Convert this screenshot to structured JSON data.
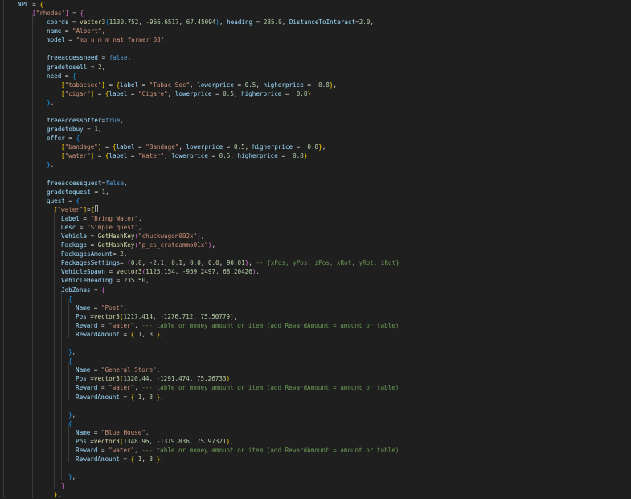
{
  "colors": {
    "background": "#1f1f1f",
    "text": "#d4d4d4",
    "keyword": "#569cd6",
    "variable": "#9cdcfe",
    "string": "#ce9178",
    "number": "#b5cea8",
    "function": "#dcdcaa",
    "comment": "#6a9955",
    "bracket_gold": "#ffd700",
    "bracket_pink": "#da70d6",
    "bracket_blue": "#179fff",
    "indent_guide": "#3b3b3b"
  },
  "lines": [
    [
      [
        "NPC",
        "variable"
      ],
      [
        " = ",
        "text"
      ],
      [
        "{",
        "bracket_gold"
      ]
    ],
    [
      [
        "[",
        "bracket_pink"
      ],
      [
        "\"rhodes\"",
        "string"
      ],
      [
        "]",
        "bracket_pink"
      ],
      [
        " = ",
        "text"
      ],
      [
        "{",
        "bracket_pink"
      ]
    ],
    [
      [
        "coords",
        "variable"
      ],
      [
        " = ",
        "text"
      ],
      [
        "vector3",
        "function"
      ],
      [
        "(",
        "bracket_blue"
      ],
      [
        "1130.752",
        "number"
      ],
      [
        ", ",
        "text"
      ],
      [
        "-966.6517",
        "number"
      ],
      [
        ", ",
        "text"
      ],
      [
        "67.45094",
        "number"
      ],
      [
        ")",
        "bracket_blue"
      ],
      [
        ", ",
        "text"
      ],
      [
        "heading",
        "variable"
      ],
      [
        " = ",
        "text"
      ],
      [
        "285.0",
        "number"
      ],
      [
        ", ",
        "text"
      ],
      [
        "DistanceToInteract",
        "variable"
      ],
      [
        "=",
        "text"
      ],
      [
        "2.0",
        "number"
      ],
      [
        ",",
        "text"
      ]
    ],
    [
      [
        "name",
        "variable"
      ],
      [
        " = ",
        "text"
      ],
      [
        "\"Albert\"",
        "string"
      ],
      [
        ",",
        "text"
      ]
    ],
    [
      [
        "model",
        "variable"
      ],
      [
        " = ",
        "text"
      ],
      [
        "\"mp_u_m_m_nat_farmer_03\"",
        "string"
      ],
      [
        ",",
        "text"
      ]
    ],
    [],
    [
      [
        "freeaccessneed",
        "variable"
      ],
      [
        " = ",
        "text"
      ],
      [
        "false",
        "keyword"
      ],
      [
        ",",
        "text"
      ]
    ],
    [
      [
        "gradetosell",
        "variable"
      ],
      [
        " = ",
        "text"
      ],
      [
        "2",
        "number"
      ],
      [
        ",",
        "text"
      ]
    ],
    [
      [
        "need",
        "variable"
      ],
      [
        " = ",
        "text"
      ],
      [
        "{",
        "bracket_blue"
      ]
    ],
    [
      [
        "[",
        "bracket_gold"
      ],
      [
        "\"tabacsec\"",
        "string"
      ],
      [
        "]",
        "bracket_gold"
      ],
      [
        " = ",
        "text"
      ],
      [
        "{",
        "bracket_gold"
      ],
      [
        "label",
        "variable"
      ],
      [
        " = ",
        "text"
      ],
      [
        "\"Tabac Sec\"",
        "string"
      ],
      [
        ", ",
        "text"
      ],
      [
        "lowerprice",
        "variable"
      ],
      [
        " = ",
        "text"
      ],
      [
        "0.5",
        "number"
      ],
      [
        ", ",
        "text"
      ],
      [
        "higherprice",
        "variable"
      ],
      [
        " =  ",
        "text"
      ],
      [
        "0.8",
        "number"
      ],
      [
        "}",
        "bracket_gold"
      ],
      [
        ",",
        "text"
      ]
    ],
    [
      [
        "[",
        "bracket_gold"
      ],
      [
        "\"cigar\"",
        "string"
      ],
      [
        "]",
        "bracket_gold"
      ],
      [
        " = ",
        "text"
      ],
      [
        "{",
        "bracket_gold"
      ],
      [
        "label",
        "variable"
      ],
      [
        " = ",
        "text"
      ],
      [
        "\"Cigare\"",
        "string"
      ],
      [
        ", ",
        "text"
      ],
      [
        "lowerprice",
        "variable"
      ],
      [
        " = ",
        "text"
      ],
      [
        "0.5",
        "number"
      ],
      [
        ", ",
        "text"
      ],
      [
        "higherprice",
        "variable"
      ],
      [
        " =  ",
        "text"
      ],
      [
        "0.8",
        "number"
      ],
      [
        "}",
        "bracket_gold"
      ]
    ],
    [
      [
        "}",
        "bracket_blue"
      ],
      [
        ",",
        "text"
      ]
    ],
    [],
    [
      [
        "freeaccessoffer",
        "variable"
      ],
      [
        "=",
        "text"
      ],
      [
        "true",
        "keyword"
      ],
      [
        ",",
        "text"
      ]
    ],
    [
      [
        "gradetobuy",
        "variable"
      ],
      [
        " = ",
        "text"
      ],
      [
        "1",
        "number"
      ],
      [
        ",",
        "text"
      ]
    ],
    [
      [
        "offer",
        "variable"
      ],
      [
        " = ",
        "text"
      ],
      [
        "{",
        "bracket_blue"
      ]
    ],
    [
      [
        "[",
        "bracket_gold"
      ],
      [
        "\"bandage\"",
        "string"
      ],
      [
        "]",
        "bracket_gold"
      ],
      [
        " = ",
        "text"
      ],
      [
        "{",
        "bracket_gold"
      ],
      [
        "label",
        "variable"
      ],
      [
        " = ",
        "text"
      ],
      [
        "\"Bandage\"",
        "string"
      ],
      [
        ", ",
        "text"
      ],
      [
        "lowerprice",
        "variable"
      ],
      [
        " = ",
        "text"
      ],
      [
        "0.5",
        "number"
      ],
      [
        ", ",
        "text"
      ],
      [
        "higherprice",
        "variable"
      ],
      [
        " =  ",
        "text"
      ],
      [
        "0.8",
        "number"
      ],
      [
        "}",
        "bracket_gold"
      ],
      [
        ",",
        "text"
      ]
    ],
    [
      [
        "[",
        "bracket_gold"
      ],
      [
        "\"water\"",
        "string"
      ],
      [
        "]",
        "bracket_gold"
      ],
      [
        " = ",
        "text"
      ],
      [
        "{",
        "bracket_gold"
      ],
      [
        "label",
        "variable"
      ],
      [
        " = ",
        "text"
      ],
      [
        "\"Water\"",
        "string"
      ],
      [
        ", ",
        "text"
      ],
      [
        "lowerprice",
        "variable"
      ],
      [
        " = ",
        "text"
      ],
      [
        "0.5",
        "number"
      ],
      [
        ", ",
        "text"
      ],
      [
        "higherprice",
        "variable"
      ],
      [
        " =  ",
        "text"
      ],
      [
        "0.8",
        "number"
      ],
      [
        "}",
        "bracket_gold"
      ]
    ],
    [
      [
        "}",
        "bracket_blue"
      ],
      [
        ",",
        "text"
      ]
    ],
    [],
    [
      [
        "freeaccessquest",
        "variable"
      ],
      [
        "=",
        "text"
      ],
      [
        "false",
        "keyword"
      ],
      [
        ",",
        "text"
      ]
    ],
    [
      [
        "gradetoquest",
        "variable"
      ],
      [
        " = ",
        "text"
      ],
      [
        "1",
        "number"
      ],
      [
        ",",
        "text"
      ]
    ],
    [
      [
        "quest",
        "variable"
      ],
      [
        " = ",
        "text"
      ],
      [
        "{",
        "bracket_blue"
      ]
    ],
    [
      [
        "[",
        "bracket_gold"
      ],
      [
        "\"water\"",
        "string"
      ],
      [
        "]",
        "bracket_gold"
      ],
      [
        "=",
        "text"
      ],
      [
        "{",
        "bracket_gold"
      ]
    ],
    [
      [
        "Label",
        "variable"
      ],
      [
        " = ",
        "text"
      ],
      [
        "\"Bring Water\"",
        "string"
      ],
      [
        ",",
        "text"
      ]
    ],
    [
      [
        "Desc",
        "variable"
      ],
      [
        " = ",
        "text"
      ],
      [
        "\"Simple quest\"",
        "string"
      ],
      [
        ",",
        "text"
      ]
    ],
    [
      [
        "Vehicle",
        "variable"
      ],
      [
        " = ",
        "text"
      ],
      [
        "GetHashKey",
        "function"
      ],
      [
        "(",
        "bracket_pink"
      ],
      [
        "\"chuckwagon002x\"",
        "string"
      ],
      [
        ")",
        "bracket_pink"
      ],
      [
        ",",
        "text"
      ]
    ],
    [
      [
        "Package",
        "variable"
      ],
      [
        " = ",
        "text"
      ],
      [
        "GetHashKey",
        "function"
      ],
      [
        "(",
        "bracket_pink"
      ],
      [
        "\"p_cs_crateammo01x\"",
        "string"
      ],
      [
        ")",
        "bracket_pink"
      ],
      [
        ",",
        "text"
      ]
    ],
    [
      [
        "PackagesAmount",
        "variable"
      ],
      [
        "= ",
        "text"
      ],
      [
        "2",
        "number"
      ],
      [
        ",",
        "text"
      ]
    ],
    [
      [
        "PackagesSettings",
        "variable"
      ],
      [
        "= ",
        "text"
      ],
      [
        "{",
        "bracket_pink"
      ],
      [
        "0.0",
        "number"
      ],
      [
        ", ",
        "text"
      ],
      [
        "-2.1",
        "number"
      ],
      [
        ", ",
        "text"
      ],
      [
        "0.1",
        "number"
      ],
      [
        ", ",
        "text"
      ],
      [
        "0.0",
        "number"
      ],
      [
        ", ",
        "text"
      ],
      [
        "0.0",
        "number"
      ],
      [
        ", ",
        "text"
      ],
      [
        "90.01",
        "number"
      ],
      [
        "}",
        "bracket_pink"
      ],
      [
        ", ",
        "text"
      ],
      [
        "-- {xPos, yPos, zPos, xRot, yRot, zRot}",
        "comment"
      ]
    ],
    [
      [
        "VehicleSpawn",
        "variable"
      ],
      [
        " = ",
        "text"
      ],
      [
        "vector3",
        "function"
      ],
      [
        "(",
        "bracket_pink"
      ],
      [
        "1125.154",
        "number"
      ],
      [
        ", ",
        "text"
      ],
      [
        "-959.2497",
        "number"
      ],
      [
        ", ",
        "text"
      ],
      [
        "68.20426",
        "number"
      ],
      [
        ")",
        "bracket_pink"
      ],
      [
        ",",
        "text"
      ]
    ],
    [
      [
        "VehicleHeading",
        "variable"
      ],
      [
        " = ",
        "text"
      ],
      [
        "235.50",
        "number"
      ],
      [
        ",",
        "text"
      ]
    ],
    [
      [
        "JobZones",
        "variable"
      ],
      [
        " = ",
        "text"
      ],
      [
        "{",
        "bracket_pink"
      ]
    ],
    [
      [
        "{",
        "bracket_blue"
      ]
    ],
    [
      [
        "Name",
        "variable"
      ],
      [
        " = ",
        "text"
      ],
      [
        "\"Post\"",
        "string"
      ],
      [
        ",",
        "text"
      ]
    ],
    [
      [
        "Pos",
        "variable"
      ],
      [
        " =",
        "text"
      ],
      [
        "vector3",
        "function"
      ],
      [
        "(",
        "bracket_gold"
      ],
      [
        "1217.414",
        "number"
      ],
      [
        ", ",
        "text"
      ],
      [
        "-1276.712",
        "number"
      ],
      [
        ", ",
        "text"
      ],
      [
        "75.50779",
        "number"
      ],
      [
        ")",
        "bracket_gold"
      ],
      [
        ",",
        "text"
      ]
    ],
    [
      [
        "Reward",
        "variable"
      ],
      [
        " = ",
        "text"
      ],
      [
        "\"water\"",
        "string"
      ],
      [
        ", ",
        "text"
      ],
      [
        "--- table or money amount or item (add RewardAmount = amount or table)",
        "comment"
      ]
    ],
    [
      [
        "RewardAmount",
        "variable"
      ],
      [
        " = ",
        "text"
      ],
      [
        "{",
        "bracket_gold"
      ],
      [
        " ",
        "text"
      ],
      [
        "1",
        "number"
      ],
      [
        ", ",
        "text"
      ],
      [
        "3",
        "number"
      ],
      [
        " ",
        "text"
      ],
      [
        "}",
        "bracket_gold"
      ],
      [
        ",",
        "text"
      ]
    ],
    [],
    [
      [
        "}",
        "bracket_blue"
      ],
      [
        ",",
        "text"
      ]
    ],
    [
      [
        "{",
        "bracket_blue"
      ]
    ],
    [
      [
        "Name",
        "variable"
      ],
      [
        " = ",
        "text"
      ],
      [
        "\"General Store\"",
        "string"
      ],
      [
        ",",
        "text"
      ]
    ],
    [
      [
        "Pos",
        "variable"
      ],
      [
        " =",
        "text"
      ],
      [
        "vector3",
        "function"
      ],
      [
        "(",
        "bracket_gold"
      ],
      [
        "1320.44",
        "number"
      ],
      [
        ", ",
        "text"
      ],
      [
        "-1291.474",
        "number"
      ],
      [
        ", ",
        "text"
      ],
      [
        "75.26733",
        "number"
      ],
      [
        ")",
        "bracket_gold"
      ],
      [
        ",",
        "text"
      ]
    ],
    [
      [
        "Reward",
        "variable"
      ],
      [
        " = ",
        "text"
      ],
      [
        "\"water\"",
        "string"
      ],
      [
        ", ",
        "text"
      ],
      [
        "--- table or money amount or item (add RewardAmount = amount or table)",
        "comment"
      ]
    ],
    [
      [
        "RewardAmount",
        "variable"
      ],
      [
        " = ",
        "text"
      ],
      [
        "{",
        "bracket_gold"
      ],
      [
        " ",
        "text"
      ],
      [
        "1",
        "number"
      ],
      [
        ", ",
        "text"
      ],
      [
        "3",
        "number"
      ],
      [
        " ",
        "text"
      ],
      [
        "}",
        "bracket_gold"
      ],
      [
        ",",
        "text"
      ]
    ],
    [],
    [
      [
        "}",
        "bracket_blue"
      ],
      [
        ",",
        "text"
      ]
    ],
    [
      [
        "{",
        "bracket_blue"
      ]
    ],
    [
      [
        "Name",
        "variable"
      ],
      [
        " = ",
        "text"
      ],
      [
        "\"Blue House\"",
        "string"
      ],
      [
        ",",
        "text"
      ]
    ],
    [
      [
        "Pos",
        "variable"
      ],
      [
        " =",
        "text"
      ],
      [
        "vector3",
        "function"
      ],
      [
        "(",
        "bracket_gold"
      ],
      [
        "1348.96",
        "number"
      ],
      [
        ", ",
        "text"
      ],
      [
        "-1319.836",
        "number"
      ],
      [
        ", ",
        "text"
      ],
      [
        "75.97321",
        "number"
      ],
      [
        ")",
        "bracket_gold"
      ],
      [
        ",",
        "text"
      ]
    ],
    [
      [
        "Reward",
        "variable"
      ],
      [
        " = ",
        "text"
      ],
      [
        "\"water\"",
        "string"
      ],
      [
        ", ",
        "text"
      ],
      [
        "--- table or money amount or item (add RewardAmount = amount or table)",
        "comment"
      ]
    ],
    [
      [
        "RewardAmount",
        "variable"
      ],
      [
        " = ",
        "text"
      ],
      [
        "{",
        "bracket_gold"
      ],
      [
        " ",
        "text"
      ],
      [
        "1",
        "number"
      ],
      [
        ", ",
        "text"
      ],
      [
        "3",
        "number"
      ],
      [
        " ",
        "text"
      ],
      [
        "}",
        "bracket_gold"
      ],
      [
        ",",
        "text"
      ]
    ],
    [],
    [
      [
        "}",
        "bracket_blue"
      ],
      [
        ",",
        "text"
      ]
    ],
    [
      [
        "}",
        "bracket_pink"
      ]
    ],
    [
      [
        "}",
        "bracket_gold"
      ],
      [
        ",",
        "text"
      ]
    ]
  ]
}
